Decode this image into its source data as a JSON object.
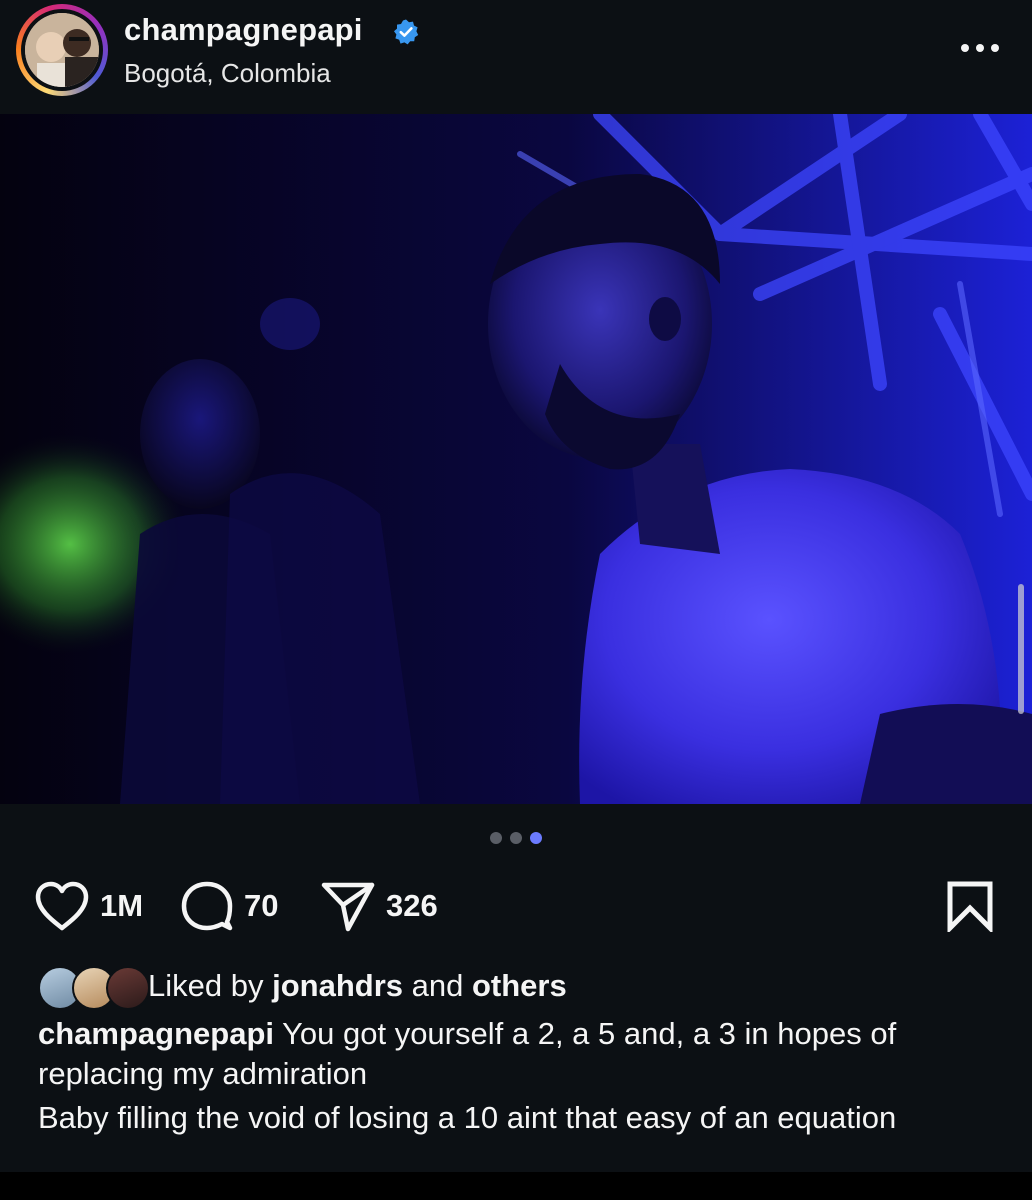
{
  "post": {
    "username": "champagnepapi",
    "location": "Bogotá, Colombia",
    "verified": true
  },
  "carousel": {
    "total": 3,
    "active_index": 2
  },
  "actions": {
    "likes": "1M",
    "comments": "70",
    "shares": "326"
  },
  "liked_by": {
    "prefix": "Liked by",
    "user": "jonahdrs",
    "connector": "and",
    "others": "others"
  },
  "caption": {
    "username": "champagnepapi",
    "line1": "You got yourself a 2, a 5 and, a 3 in hopes of replacing my admiration",
    "line2": "Baby filling the void of losing a 10 aint that easy of an equation"
  },
  "icons": {
    "more": "more-horizontal-icon",
    "like": "heart-icon",
    "comment": "comment-bubble-icon",
    "share": "paper-plane-icon",
    "save": "bookmark-icon",
    "verified": "verified-badge-icon"
  },
  "colors": {
    "background": "#0c1014",
    "text": "#f5f5f5",
    "verified_blue": "#3897f0",
    "carousel_active_dot": "#6b7bff",
    "carousel_dot": "#5a5e66"
  }
}
